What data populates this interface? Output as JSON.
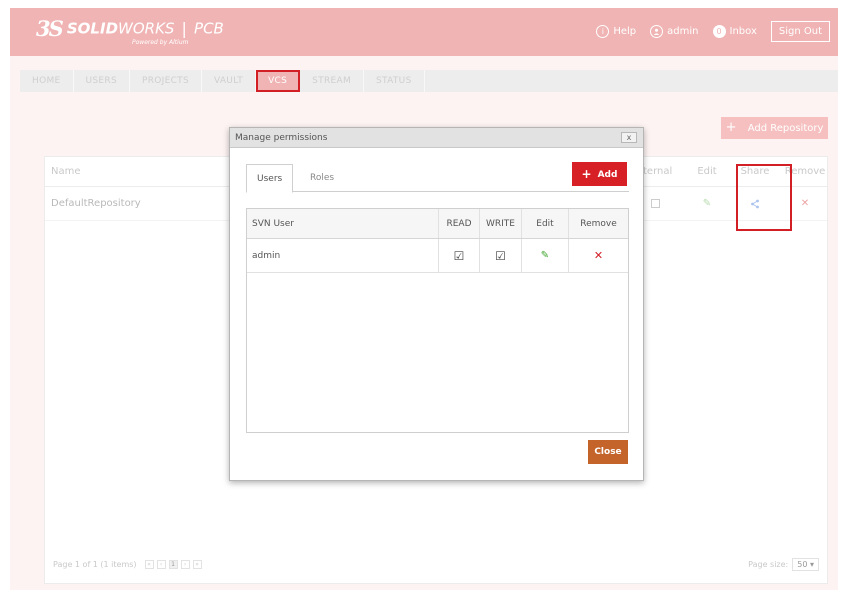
{
  "header": {
    "logo_ds": "3S",
    "brand_bold": "SOLID",
    "brand_thin": "WORKS",
    "brand_sep": "|",
    "product": "PCB",
    "powered_by": "Powered by Altium",
    "help_label": "Help",
    "user_label": "admin",
    "inbox_count": "0",
    "inbox_label": "Inbox",
    "signout_label": "Sign Out"
  },
  "nav": {
    "items": [
      "HOME",
      "USERS",
      "PROJECTS",
      "VAULT",
      "VCS",
      "STREAM",
      "STATUS"
    ],
    "active": "VCS"
  },
  "actions": {
    "add_repository": "Add Repository"
  },
  "repo_grid": {
    "columns": {
      "name": "Name",
      "internal": "ternal",
      "edit": "Edit",
      "share": "Share",
      "remove": "Remove"
    },
    "rows": [
      {
        "name": "DefaultRepository"
      }
    ],
    "pager_text": "Page 1 of 1 (1 items)",
    "current_page": "1",
    "page_size_label": "Page size:",
    "page_size_value": "50"
  },
  "modal": {
    "title": "Manage permissions",
    "close_x": "x",
    "tabs": [
      "Users",
      "Roles"
    ],
    "active_tab": "Users",
    "add_label": "Add",
    "table": {
      "columns": [
        "SVN User",
        "READ",
        "WRITE",
        "Edit",
        "Remove"
      ],
      "rows": [
        {
          "user": "admin",
          "read": true,
          "write": true
        }
      ]
    },
    "close_label": "Close"
  },
  "colors": {
    "header_bg": "#f0b4b4",
    "highlight_red": "#d21f26",
    "add_button": "#d71f26",
    "close_button": "#c4642b",
    "edit_green": "#3da52b"
  },
  "icons": {
    "help": "info-circle-icon",
    "user": "user-circle-icon",
    "share": "share-icon",
    "edit": "pencil-icon",
    "remove": "x-icon"
  }
}
